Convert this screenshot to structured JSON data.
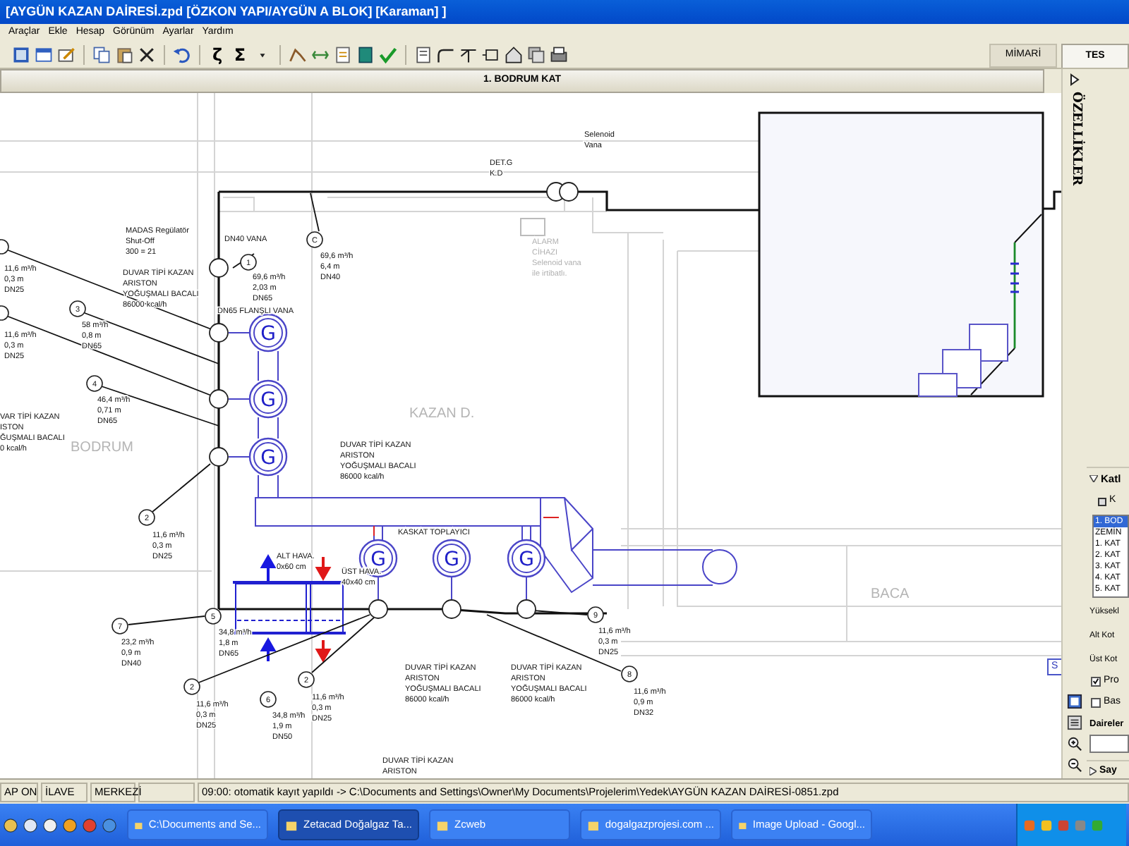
{
  "window": {
    "title": "[AYGÜN KAZAN DAİRESİ.zpd [ÖZKON YAPI/AYGÜN A BLOK]  [Karaman] ]"
  },
  "menu": [
    "Araçlar",
    "Ekle",
    "Hesap",
    "Görünüm",
    "Ayarlar",
    "Yardım"
  ],
  "toolbar": {
    "glyphs": [
      "ζ",
      "Σ"
    ]
  },
  "mode_tabs": [
    {
      "label": "MİMARİ",
      "selected": false
    },
    {
      "label": "TES",
      "selected": true
    }
  ],
  "floor_header": "1. BODRUM KAT",
  "drawing": {
    "annotations": [
      {
        "kind": "note",
        "lines": [
          "MADAS Regülatör",
          "Shut-Off",
          "300 = 21"
        ]
      },
      {
        "kind": "note",
        "lines": [
          "DUVAR TİPİ KAZAN",
          "ARISTON",
          "YOĞUŞMALI BACALI",
          "86000 kcal/h"
        ]
      },
      {
        "kind": "note",
        "lines": [
          "DN40 VANA"
        ]
      },
      {
        "kind": "note",
        "lines": [
          "69,6 m³/h",
          "2,03 m",
          "DN65"
        ]
      },
      {
        "kind": "note",
        "lines": [
          "DN65 FLANŞLI VANA"
        ]
      },
      {
        "kind": "note",
        "lines": [
          "69,6 m³/h",
          "6,4 m",
          "DN40"
        ]
      },
      {
        "kind": "note",
        "lines": [
          "11,6 m³/h",
          "0,3 m",
          "DN25"
        ]
      },
      {
        "kind": "note",
        "lines": [
          "11,6 m³/h",
          "0,3 m",
          "DN25"
        ]
      },
      {
        "kind": "note",
        "lines": [
          "58 m³/h",
          "0,8 m",
          "DN65"
        ]
      },
      {
        "kind": "note",
        "lines": [
          "46,4 m³/h",
          "0,71 m",
          "DN65"
        ]
      },
      {
        "kind": "note",
        "lines": [
          "VAR TİPİ KAZAN",
          "ISTON",
          "ĞUŞMALI BACALI",
          "0 kcal/h"
        ]
      },
      {
        "kind": "note",
        "lines": [
          "DUVAR TİPİ KAZAN",
          "ARISTON",
          "YOĞUŞMALI BACALI",
          "86000 kcal/h"
        ]
      },
      {
        "kind": "note",
        "lines": [
          "DET.G",
          "K.D"
        ]
      },
      {
        "kind": "note",
        "lines": [
          "Selenoid",
          "Vana"
        ]
      },
      {
        "kind": "faded",
        "lines": [
          "ALARM",
          "CİHAZI",
          "Selenoid vana",
          "ile irtibatlı."
        ]
      },
      {
        "kind": "note",
        "lines": [
          "KASKAT TOPLAYICI"
        ]
      },
      {
        "kind": "note",
        "lines": [
          "11,6 m³/h",
          "0,3 m",
          "DN25"
        ]
      },
      {
        "kind": "note",
        "lines": [
          "ALT HAVA.",
          "0x60 cm"
        ]
      },
      {
        "kind": "note",
        "lines": [
          "ÜST HAVA.",
          "40x40 cm"
        ]
      },
      {
        "kind": "note",
        "lines": [
          "23,2 m³/h",
          "0,9 m",
          "DN40"
        ]
      },
      {
        "kind": "note",
        "lines": [
          "34,8 m³/h",
          "1,8 m",
          "DN65"
        ]
      },
      {
        "kind": "note",
        "lines": [
          "11,6 m³/h",
          "0,3 m",
          "DN25"
        ]
      },
      {
        "kind": "note",
        "lines": [
          "34,8 m³/h",
          "1,9 m",
          "DN50"
        ]
      },
      {
        "kind": "note",
        "lines": [
          "11,6 m³/h",
          "0,3 m",
          "DN25"
        ]
      },
      {
        "kind": "note",
        "lines": [
          "DUVAR TİPİ KAZAN",
          "ARISTON",
          "YOĞUŞMALI BACALI",
          "86000 kcal/h"
        ]
      },
      {
        "kind": "note",
        "lines": [
          "DUVAR TİPİ KAZAN",
          "ARISTON",
          "YOĞUŞMALI BACALI",
          "86000 kcal/h"
        ]
      },
      {
        "kind": "note",
        "lines": [
          "11,6 m³/h",
          "0,3 m",
          "DN25"
        ]
      },
      {
        "kind": "note",
        "lines": [
          "11,6 m³/h",
          "0,9 m",
          "DN32"
        ]
      },
      {
        "kind": "note",
        "lines": [
          "DUVAR TİPİ KAZAN",
          "ARISTON"
        ]
      }
    ],
    "rooms": [
      "BODRUM",
      "KAZAN D.",
      "BACA"
    ],
    "markers": [
      "1",
      "C",
      "3",
      "4",
      "2",
      "5",
      "7",
      "2",
      "6",
      "2",
      "9",
      "8"
    ],
    "boiler_symbols": [
      "G",
      "G",
      "G",
      "G",
      "G",
      "G"
    ],
    "side_button": "S"
  },
  "properties_panel": {
    "vertical_title": "ÖZELLİKLER",
    "section": "Katl",
    "kot_button": "K",
    "floors": [
      {
        "label": "1. BOD",
        "selected": true
      },
      {
        "label": "ZEMİN",
        "selected": false
      },
      {
        "label": "1. KAT",
        "selected": false
      },
      {
        "label": "2. KAT",
        "selected": false
      },
      {
        "label": "3. KAT",
        "selected": false
      },
      {
        "label": "4. KAT",
        "selected": false
      },
      {
        "label": "5. KAT",
        "selected": false
      }
    ],
    "labels": [
      "Yüksekl",
      "Alt Kot",
      "Üst Kot"
    ],
    "checkboxes": [
      {
        "label": "Pro",
        "checked": true
      },
      {
        "label": "Bas",
        "checked": false
      }
    ],
    "list_label": "Daireler",
    "footer_section": "Say"
  },
  "status_bar": [
    "AP ON",
    "İLAVE",
    "MERKEZİ",
    "09:00: otomatik kayıt yapıldı -> C:\\Documents and Settings\\Owner\\My Documents\\Projelerim\\Yedek\\AYGÜN KAZAN DAİRESİ-0851.zpd"
  ],
  "taskbar": [
    {
      "label": "C:\\Documents and Se...",
      "selected": false
    },
    {
      "label": "Zetacad Doğalgaz Ta...",
      "selected": true
    },
    {
      "label": "Zcweb",
      "selected": false
    },
    {
      "label": "dogalgazprojesi.com ...",
      "selected": false
    },
    {
      "label": "Image Upload - Googl...",
      "selected": false
    }
  ]
}
